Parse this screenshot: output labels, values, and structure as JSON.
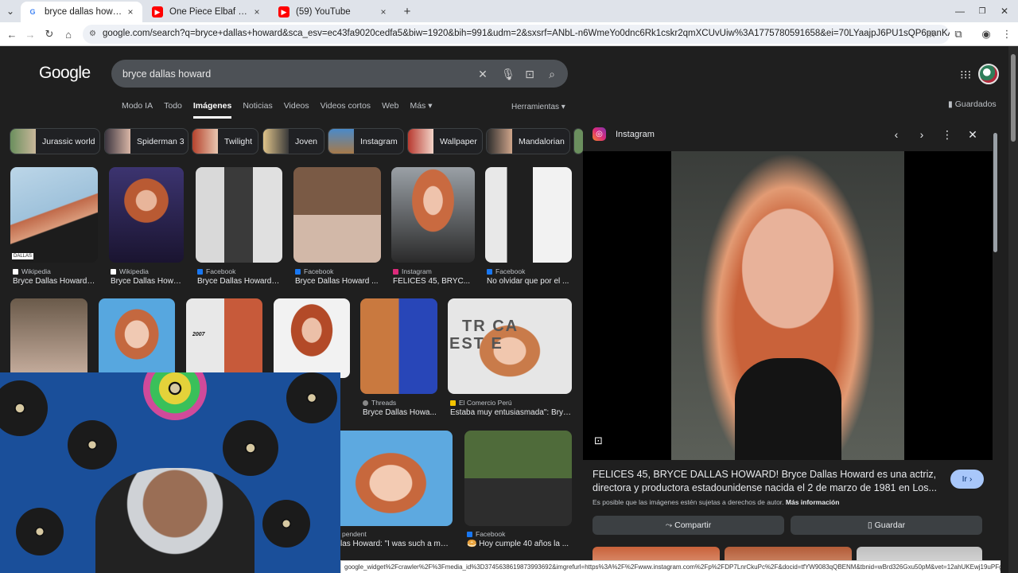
{
  "browser": {
    "tabs": [
      {
        "title": "bryce dallas howard - Buscar co",
        "close": "×",
        "active": true,
        "favicon": "G"
      },
      {
        "title": "One Piece Elbaf Mural Reveale",
        "close": "×",
        "active": false,
        "favicon": "▶"
      },
      {
        "title": "(59) YouTube",
        "close": "×",
        "active": false,
        "favicon": "▶"
      }
    ],
    "new_tab": "+",
    "url": "google.com/search?q=bryce+dallas+howard&sca_esv=ec43fa9020cedfa5&biw=1920&bih=991&udm=2&sxsrf=ANbL-n6WmeYo0dnc6Rk1cskr2qmXCUvUiw%3A1775780591658&ei=70LYaajpJ6PU1sQP6panKA&oq=BRYCE&gs_lp=Egtnd3Mtd2l6LWlt..."
  },
  "google": {
    "logo": "Google",
    "query": "bryce dallas howard",
    "nav_tabs": [
      "Modo IA",
      "Todo",
      "Imágenes",
      "Noticias",
      "Videos",
      "Videos cortos",
      "Web",
      "Más ▾"
    ],
    "active_tab": "Imágenes",
    "tools": "Herramientas ▾",
    "saved": "Guardados"
  },
  "chips": [
    {
      "label": "Jurassic world"
    },
    {
      "label": "Spiderman 3"
    },
    {
      "label": "Twilight"
    },
    {
      "label": "Joven"
    },
    {
      "label": "Instagram"
    },
    {
      "label": "Wallpaper"
    },
    {
      "label": "Mandalorian"
    }
  ],
  "results_row1": [
    {
      "source": "Wikipedia",
      "title": "Bryce Dallas Howard ..."
    },
    {
      "source": "Wikipedia",
      "title": "Bryce Dallas Howa..."
    },
    {
      "source": "Facebook",
      "title": "Bryce Dallas Howard ..."
    },
    {
      "source": "Facebook",
      "title": "Bryce Dallas Howard ..."
    },
    {
      "source": "Instagram",
      "title": "FELICES 45, BRYC..."
    },
    {
      "source": "Facebook",
      "title": "No olvidar que por el ..."
    }
  ],
  "results_row2": [
    {
      "source": "Threads",
      "title": "Bryce Dallas Howa..."
    },
    {
      "source": "El Comercio Perú",
      "title": "Estaba muy entusiasmada\": Bryc..."
    }
  ],
  "results_row3": [
    {
      "source": "pendent",
      "title": "las Howard: \"I was such a mes..."
    },
    {
      "source": "Facebook",
      "title": "🥯 Hoy cumple 40 años la ..."
    }
  ],
  "image_text": {
    "year": "2007",
    "tribeca": "TR   CA",
    "estate": "EST      E",
    "dallas": "DALLAS"
  },
  "panel": {
    "source": "Instagram",
    "title": "FELICES 45, BRYCE DALLAS HOWARD! Bryce Dallas Howard es una actriz, directora y productora estadounidense nacida el 2 de marzo de 1981 en Los...",
    "go": "Ir ›",
    "notice": "Es posible que las imágenes estén sujetas a derechos de autor.",
    "more_info": "Más información",
    "share": "Compartir",
    "save": "Guardar"
  },
  "status_url": "google_widget%2Fcrawler%2F%3Fmedia_id%3D3745638619873993692&imgrefurl=https%3A%2F%2Fwww.instagram.com%2Fp%2FDP7LnrCkuPc%2F&docid=tfYW9083qQBENM&tbnid=wBrd326Gxu50pM&vet=12ahUKEwj19uPFguK...",
  "colors": {
    "accent": "#a8c7fa",
    "page_bg": "#1f1f1f",
    "chip_border": "#3c4043"
  }
}
